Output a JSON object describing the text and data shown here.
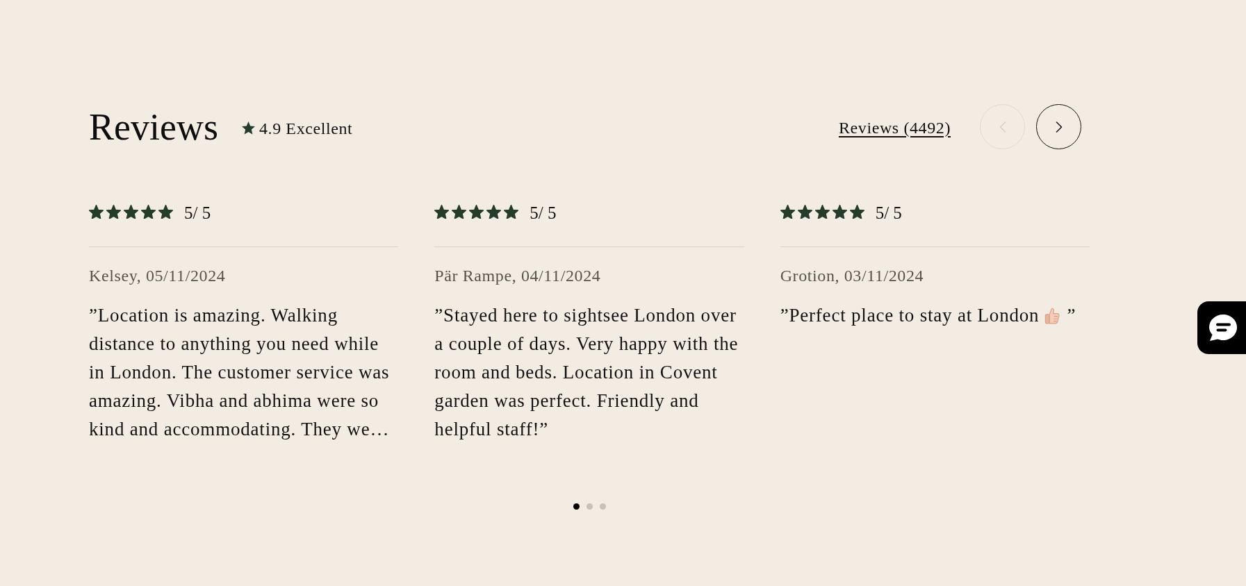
{
  "header": {
    "title": "Reviews",
    "rating_text": "4.9 Excellent",
    "link": "Reviews (4492)",
    "nav_buttons": [
      {
        "kind": "prev",
        "disabled": true
      },
      {
        "kind": "next",
        "disabled": false
      }
    ]
  },
  "reviews": [
    {
      "stars": 5,
      "score": "5/ 5",
      "author": "Kelsey, 05/11/2024",
      "body": [
        {
          "kind": "text",
          "text": "”Location is amazing. Walking distance to anything you need while in London. The customer service was amazing. Vibha and abhima were so kind and accommodating. They we…"
        }
      ]
    },
    {
      "stars": 5,
      "score": "5/ 5",
      "author": "Pär Rampe, 04/11/2024",
      "body": [
        {
          "kind": "text",
          "text": "”Stayed here to sightsee London over a couple of days. Very happy with the room and beds. Location in Covent garden was perfect. Friendly and helpful staff!”"
        }
      ]
    },
    {
      "stars": 5,
      "score": "5/ 5",
      "author": "Grotion, 03/11/2024",
      "body": [
        {
          "kind": "text",
          "text": "”Perfect place to stay at London"
        },
        {
          "kind": "emoji"
        },
        {
          "kind": "text",
          "text": "”"
        }
      ]
    }
  ],
  "pagination": [
    {
      "selected": true
    },
    {
      "selected": false
    },
    {
      "selected": false
    }
  ]
}
